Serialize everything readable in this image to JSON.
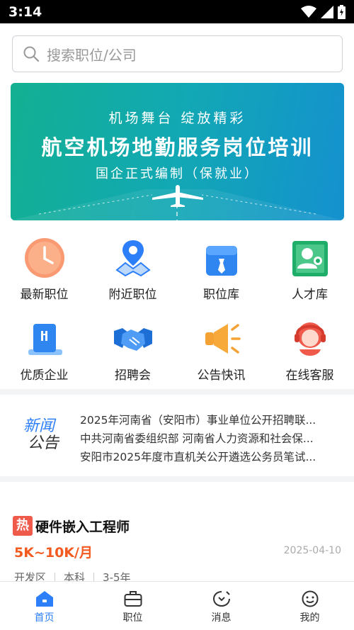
{
  "status_bar": {
    "time": "3:14"
  },
  "search": {
    "placeholder": "搜索职位/公司"
  },
  "banner": {
    "line1": "机场舞台  绽放精彩",
    "line2": "航空机场地勤服务岗位培训",
    "line3": "国企正式编制（保就业）"
  },
  "quick_menu": [
    {
      "label": "最新职位",
      "icon": "clock-icon"
    },
    {
      "label": "附近职位",
      "icon": "location-pin-icon"
    },
    {
      "label": "职位库",
      "icon": "briefcase-icon"
    },
    {
      "label": "人才库",
      "icon": "profile-card-icon"
    },
    {
      "label": "优质企业",
      "icon": "building-icon"
    },
    {
      "label": "招聘会",
      "icon": "handshake-icon"
    },
    {
      "label": "公告快讯",
      "icon": "megaphone-icon"
    },
    {
      "label": "在线客服",
      "icon": "headset-icon"
    }
  ],
  "news": {
    "logo_line1": "新闻",
    "logo_line2": "公告",
    "items": [
      "2025年河南省（安阳市）事业单位公开招聘联...",
      "中共河南省委组织部 河南省人力资源和社会保...",
      "安阳市2025年度市直机关公开遴选公务员笔试..."
    ]
  },
  "job": {
    "hot_badge": "热",
    "title": "硬件嵌入工程师",
    "salary": "5K~10K/月",
    "date": "2025-04-10",
    "meta": [
      "开发区",
      "本科",
      "3-5年"
    ]
  },
  "tabbar": [
    {
      "label": "首页",
      "icon": "home-icon",
      "active": true
    },
    {
      "label": "职位",
      "icon": "briefcase-icon"
    },
    {
      "label": "消息",
      "icon": "message-icon"
    },
    {
      "label": "我的",
      "icon": "smiley-icon"
    }
  ],
  "colors": {
    "accent": "#2d7ff9",
    "salary": "#f25a20",
    "hot": "#f05a4b"
  }
}
